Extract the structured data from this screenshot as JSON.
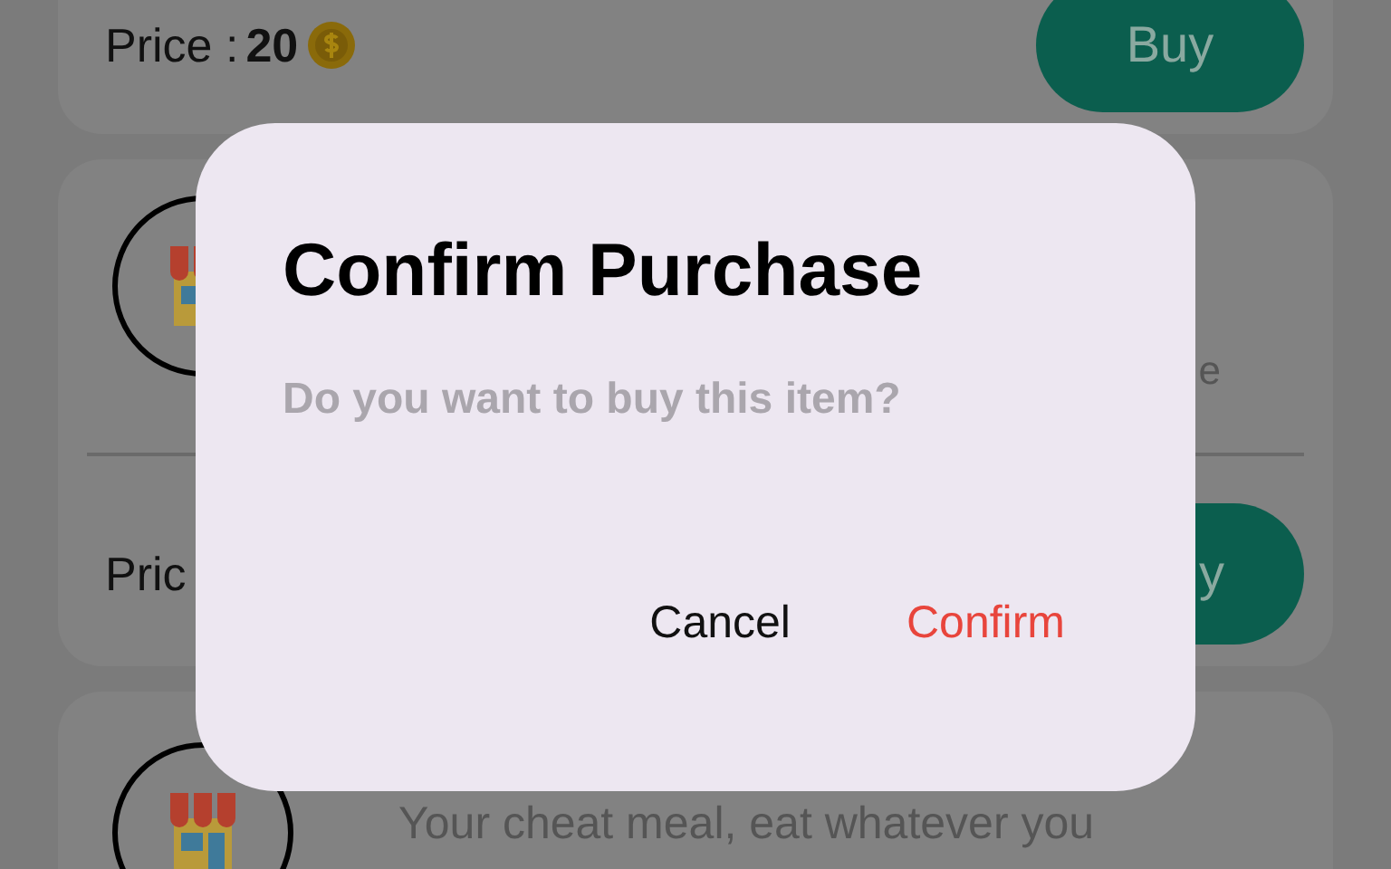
{
  "cards": [
    {
      "price_label": "Price :",
      "price": "20",
      "buy": "Buy"
    },
    {
      "description": "e",
      "price_label": "Pric",
      "buy": "y"
    },
    {
      "description": "Your cheat meal, eat whatever you"
    }
  ],
  "dialog": {
    "title": "Confirm Purchase",
    "message": "Do you want to buy this item?",
    "buttons": [
      {
        "label": "Cancel",
        "kind": "neutral"
      },
      {
        "label": "Confirm",
        "kind": "primary"
      }
    ]
  }
}
